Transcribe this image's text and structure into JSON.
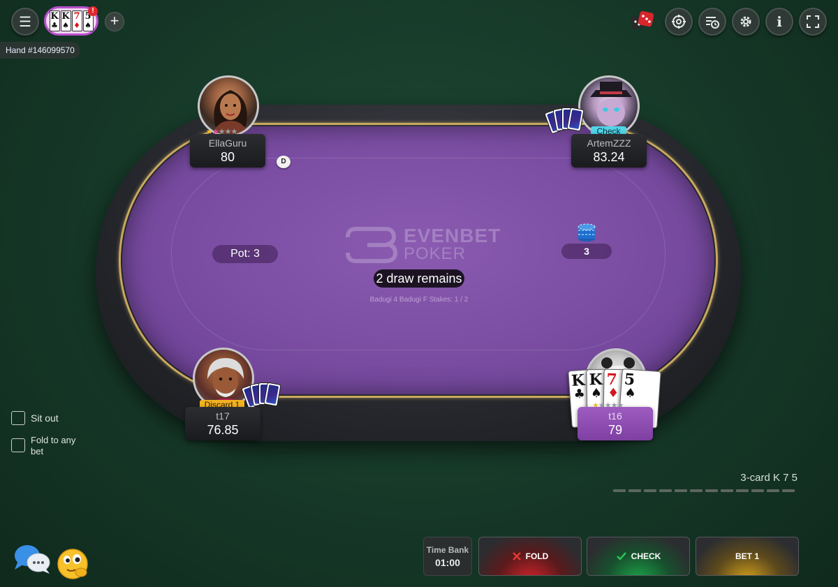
{
  "header": {
    "hand_label": "Hand #146099570",
    "mini_table": {
      "cards": [
        {
          "rank": "K",
          "suit": "♣",
          "color": "black"
        },
        {
          "rank": "K",
          "suit": "♠",
          "color": "black"
        },
        {
          "rank": "7",
          "suit": "♦",
          "color": "red"
        },
        {
          "rank": "5",
          "suit": "♠",
          "color": "black"
        }
      ],
      "notification": "!"
    },
    "icons": [
      "menu-icon",
      "add-table-icon",
      "dice-icon",
      "target-icon",
      "history-icon",
      "gear-icon",
      "info-icon",
      "fullscreen-icon"
    ]
  },
  "table": {
    "logo_line1": "EVENBET",
    "logo_line2": "POKER",
    "pot_label": "Pot: 3",
    "status_message": "2 draw remains",
    "stakes_text": "Badugi 4 Badugi F Stakes: 1 / 2",
    "bet_amount": "3",
    "dealer_button": "D",
    "felt_color": "#7b4ea3"
  },
  "players": [
    {
      "name": "EllaGuru",
      "stack": "80"
    },
    {
      "name": "ArtemZZZ",
      "stack": "83.24",
      "action": "Check"
    },
    {
      "name": "t17",
      "stack": "76.85",
      "action": "Discard 1"
    },
    {
      "name": "t16",
      "stack": "79"
    }
  ],
  "hero_hand": [
    {
      "rank": "K",
      "suit": "♣",
      "color": "black"
    },
    {
      "rank": "K",
      "suit": "♠",
      "color": "black"
    },
    {
      "rank": "7",
      "suit": "♦",
      "color": "red"
    },
    {
      "rank": "5",
      "suit": "♠",
      "color": "black"
    }
  ],
  "options": {
    "sit_out": "Sit out",
    "fold_to_any_bet": "Fold to any bet"
  },
  "hand_info": {
    "hand_name": "3-card K 7 5"
  },
  "actions": {
    "time_bank_label": "Time Bank",
    "time_bank_value": "01:00",
    "fold": "FOLD",
    "check": "CHECK",
    "bet": "BET 1",
    "colors": {
      "fold": "#d2232a",
      "check": "#1ca64a",
      "bet": "#d6a11b"
    }
  }
}
